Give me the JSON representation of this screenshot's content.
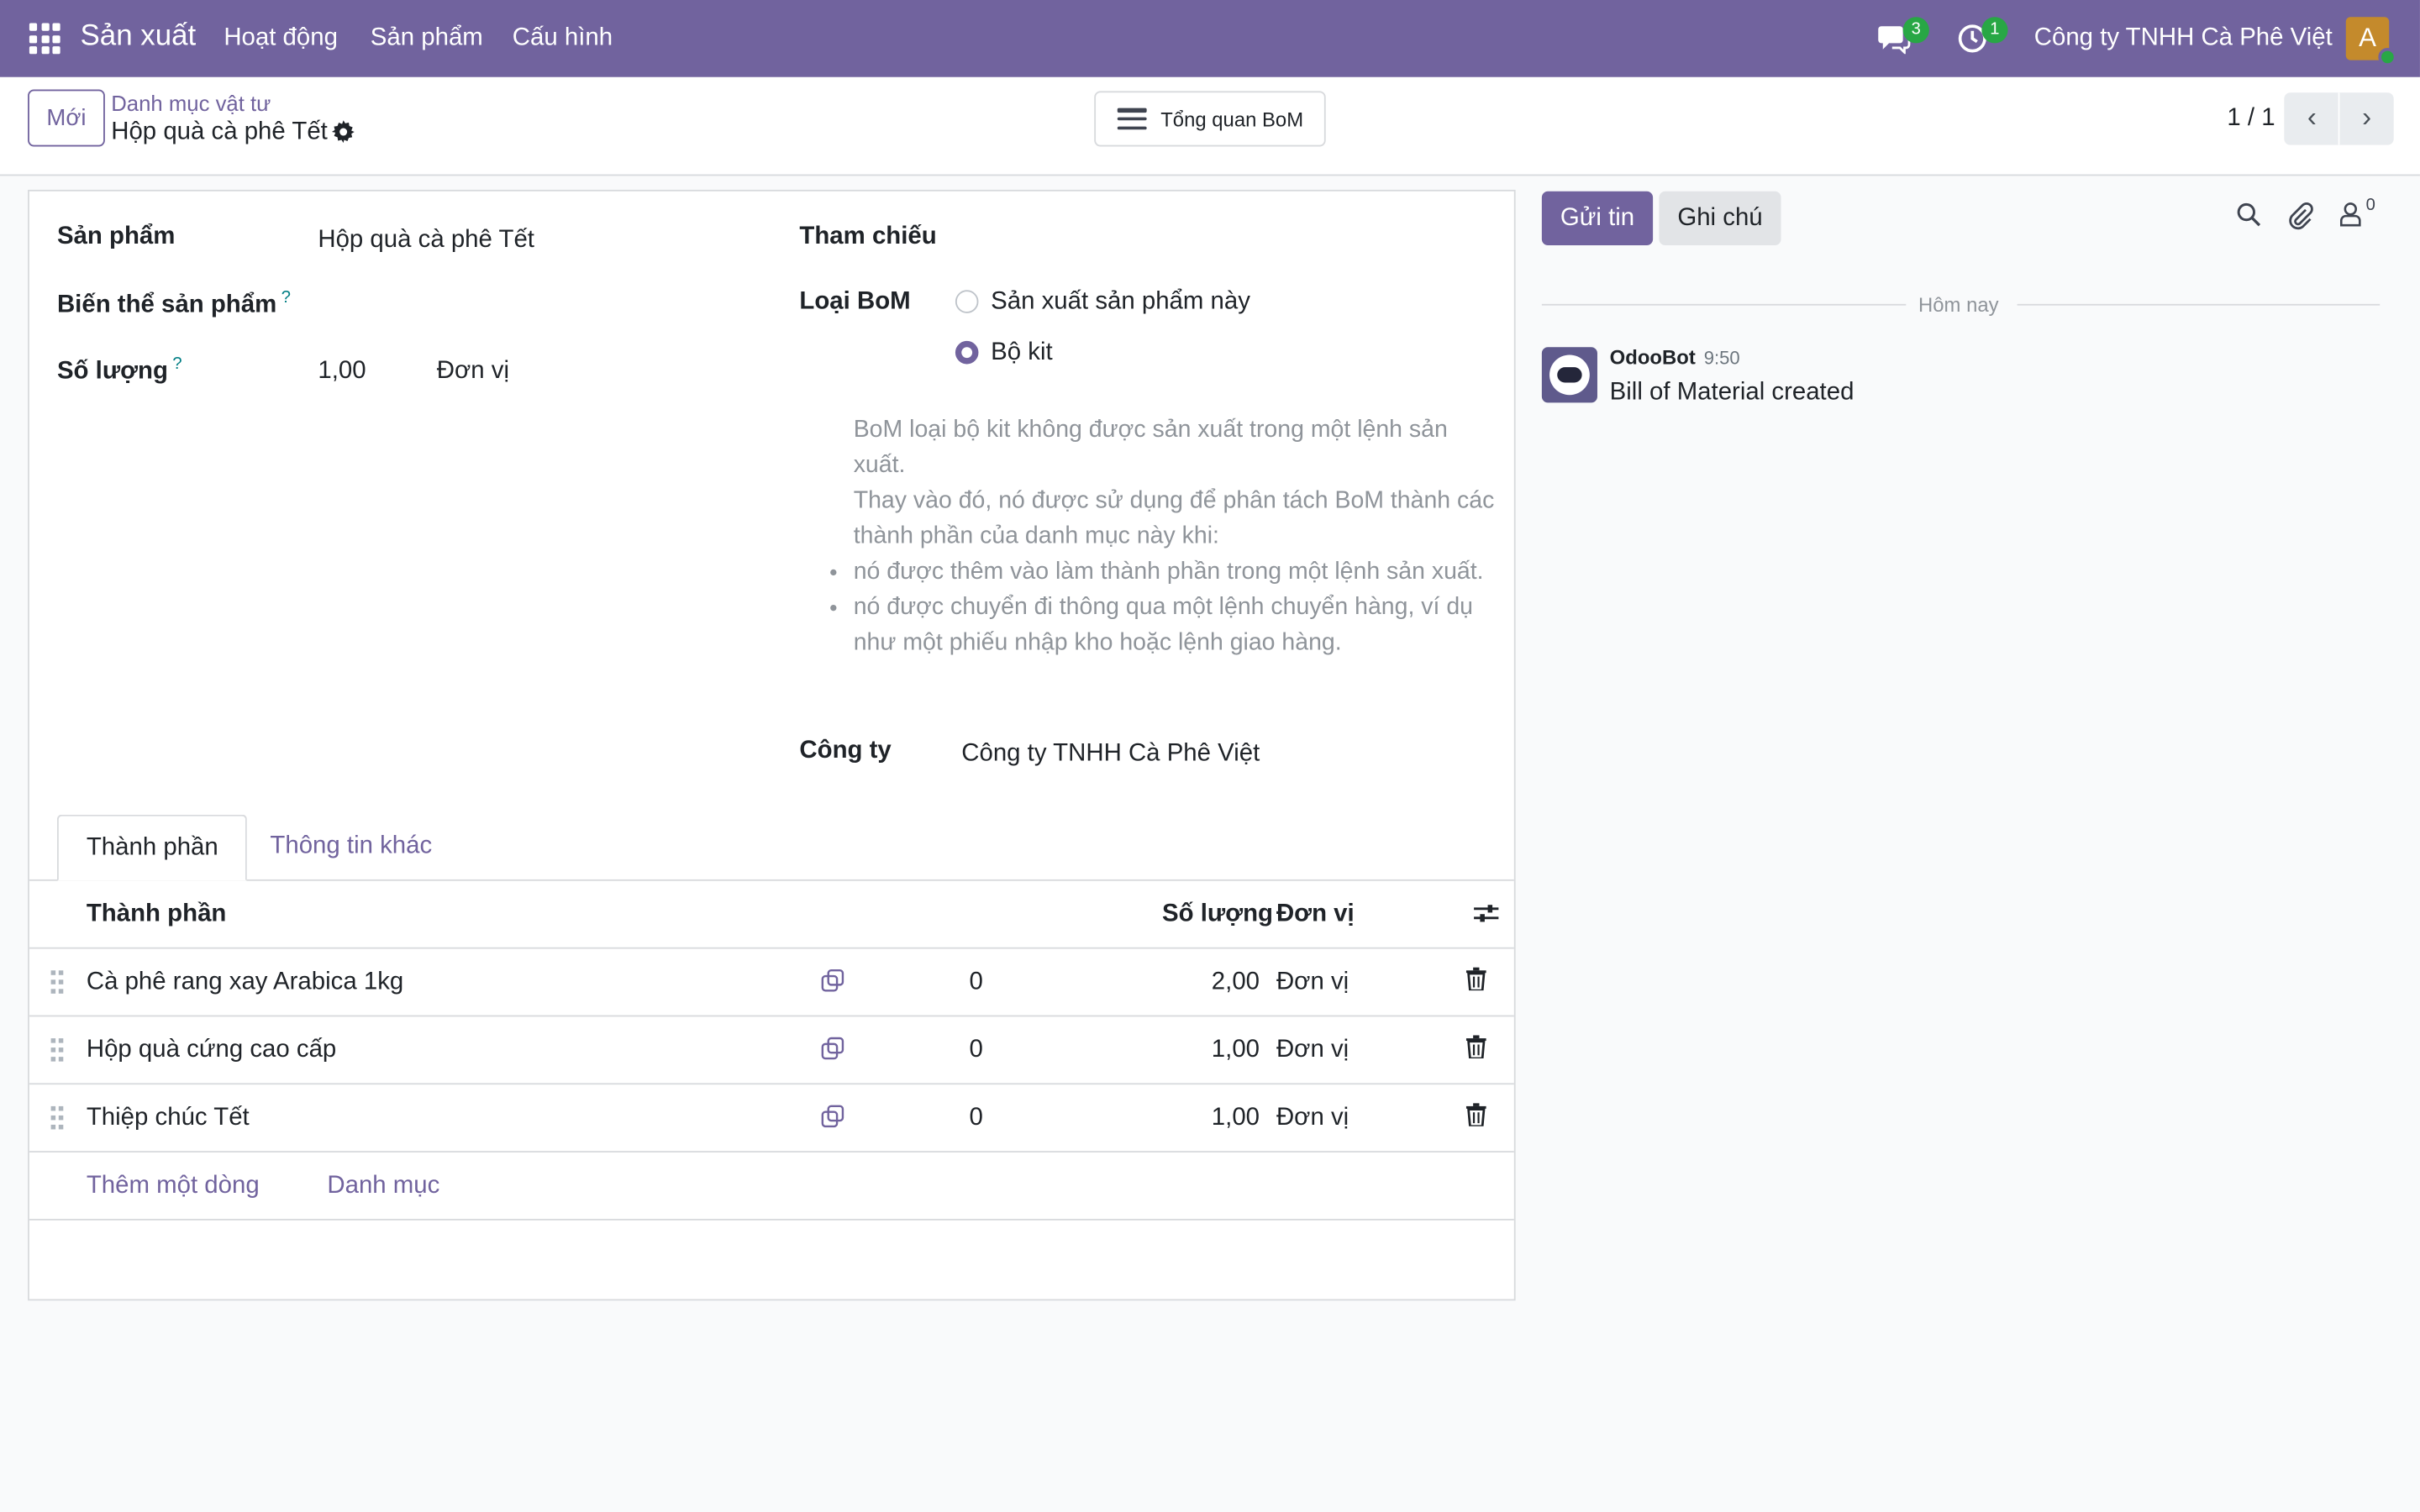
{
  "navbar": {
    "app_name": "Sản xuất",
    "menus": [
      "Hoạt động",
      "Sản phẩm",
      "Cấu hình"
    ],
    "messages_count": "3",
    "activities_count": "1",
    "company": "Công ty TNHH Cà Phê Việt",
    "avatar_initial": "A",
    "colors": {
      "navbar_bg": "#71639e",
      "badge": "#28a745",
      "avatar_bg": "#c48a2c"
    }
  },
  "control": {
    "new_button": "Mới",
    "breadcrumb_parent": "Danh mục vật tư",
    "record_title": "Hộp quà cà phê Tết",
    "bom_overview_button": "Tổng quan BoM",
    "pager": "1 / 1"
  },
  "form": {
    "product_label": "Sản phẩm",
    "product_value": "Hộp quà cà phê Tết",
    "variant_label": "Biến thể sản phẩm",
    "quantity_label": "Số lượng",
    "quantity_value": "1,00",
    "quantity_uom": "Đơn vị",
    "reference_label": "Tham chiếu",
    "bom_type_label": "Loại BoM",
    "bom_type_options": [
      "Sản xuất sản phẩm này",
      "Bộ kit"
    ],
    "bom_type_selected": "Bộ kit",
    "help_line1": "BoM loại bộ kit không được sản xuất trong một lệnh sản xuất.",
    "help_line2": "Thay vào đó, nó được sử dụng để phân tách BoM thành các thành phần của danh mục này khi:",
    "help_bullets": [
      "nó được thêm vào làm thành phần trong một lệnh sản xuất.",
      "nó được chuyển đi thông qua một lệnh chuyển hàng, ví dụ như một phiếu nhập kho hoặc lệnh giao hàng."
    ],
    "company_label": "Công ty",
    "company_value": "Công ty TNHH Cà Phê Việt",
    "help_mark": "?"
  },
  "tabs": [
    "Thành phần",
    "Thông tin khác"
  ],
  "components_table": {
    "headers": {
      "component": "Thành phần",
      "quantity": "Số lượng",
      "uom": "Đơn vị"
    },
    "rows": [
      {
        "name": "Cà phê rang xay Arabica 1kg",
        "extra": "0",
        "quantity": "2,00",
        "uom": "Đơn vị"
      },
      {
        "name": "Hộp quà cứng cao cấp",
        "extra": "0",
        "quantity": "1,00",
        "uom": "Đơn vị"
      },
      {
        "name": "Thiệp chúc Tết",
        "extra": "0",
        "quantity": "1,00",
        "uom": "Đơn vị"
      }
    ],
    "add_line": "Thêm một dòng",
    "catalog": "Danh mục"
  },
  "chatter": {
    "send_message": "Gửi tin",
    "log_note": "Ghi chú",
    "followers_count": "0",
    "date_separator": "Hôm nay",
    "messages": [
      {
        "author": "OdooBot",
        "time": "9:50",
        "body": "Bill of Material created"
      }
    ]
  }
}
